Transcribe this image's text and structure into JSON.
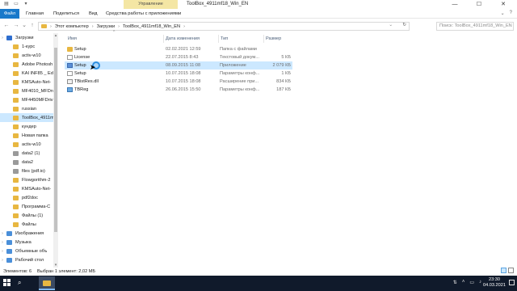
{
  "window": {
    "title": "ToolBox_4911mf18_Win_EN",
    "manage_tab": "Управление",
    "controls": [
      "—",
      "☐",
      "✕"
    ]
  },
  "ribbon": {
    "tabs": [
      "Файл",
      "Главная",
      "Поделиться",
      "Вид",
      "Средства работы с приложениями"
    ]
  },
  "address": {
    "segments": [
      "Этот компьютер",
      "Загрузки",
      "ToolBox_4911mf18_Win_EN"
    ],
    "search_placeholder": "Поиск: ToolBox_4911mf18_Win_EN"
  },
  "sidebar": {
    "items": [
      {
        "label": "Загрузки",
        "icon": "download-icon",
        "color": "#2f6fcf"
      },
      {
        "label": "1-курс",
        "icon": "folder-icon",
        "color": "#e8b741"
      },
      {
        "label": "activ-w10",
        "icon": "folder-icon",
        "color": "#e8b741"
      },
      {
        "label": "Adobe Photosh",
        "icon": "folder-icon",
        "color": "#e8b741"
      },
      {
        "label": "KAI INF85 _ Edu",
        "icon": "folder-icon",
        "color": "#e8b741"
      },
      {
        "label": "KMSAuto-Net-",
        "icon": "folder-icon",
        "color": "#e8b741"
      },
      {
        "label": "MF4010_MFDrv",
        "icon": "folder-icon",
        "color": "#e8b741"
      },
      {
        "label": "MF4450MFDriv",
        "icon": "folder-icon",
        "color": "#e8b741"
      },
      {
        "label": "russian",
        "icon": "folder-icon",
        "color": "#e8b741"
      },
      {
        "label": "ToolBox_4911m",
        "icon": "folder-icon",
        "color": "#e8b741",
        "selected": true
      },
      {
        "label": "кундер",
        "icon": "folder-icon",
        "color": "#e8b741"
      },
      {
        "label": "Новая папка",
        "icon": "folder-icon",
        "color": "#e8b741"
      },
      {
        "label": "activ-w10",
        "icon": "folder-icon",
        "color": "#e8b741"
      },
      {
        "label": "data2 (1)",
        "icon": "file-icon",
        "color": "#9a9a9a"
      },
      {
        "label": "data2",
        "icon": "file-icon",
        "color": "#9a9a9a"
      },
      {
        "label": "files (pdf.io)",
        "icon": "file-icon",
        "color": "#9a9a9a"
      },
      {
        "label": "Flowgorithm-2",
        "icon": "folder-icon",
        "color": "#e8b741"
      },
      {
        "label": "KMSAuto-Net-",
        "icon": "folder-icon",
        "color": "#e8b741"
      },
      {
        "label": "pdf2doc",
        "icon": "folder-icon",
        "color": "#e8b741"
      },
      {
        "label": "Программа-C",
        "icon": "folder-icon",
        "color": "#e8b741"
      },
      {
        "label": "Файлы (1)",
        "icon": "folder-icon",
        "color": "#e8b741"
      },
      {
        "label": "Файлы",
        "icon": "folder-icon",
        "color": "#e8b741"
      },
      {
        "label": "Изображения",
        "icon": "images-icon",
        "color": "#4a8fd9"
      },
      {
        "label": "Музыка",
        "icon": "music-icon",
        "color": "#4a8fd9"
      },
      {
        "label": "Объемные объ",
        "icon": "3d-objects-icon",
        "color": "#4a8fd9"
      },
      {
        "label": "Рабочий стол",
        "icon": "desktop-icon",
        "color": "#4a8fd9"
      }
    ]
  },
  "columns": {
    "name": "Имя",
    "date": "Дата изменения",
    "type": "Тип",
    "size": "Размер"
  },
  "files": [
    {
      "name": "Setup",
      "date": "02.02.2021 12:59",
      "type": "Папка с файлами",
      "size": "",
      "icon": "folder-icon"
    },
    {
      "name": "License",
      "date": "22.07.2015 8:43",
      "type": "Текстовый докум...",
      "size": "5 КБ",
      "icon": "text-file-icon"
    },
    {
      "name": "Setup",
      "date": "08.09.2015 11:08",
      "type": "Приложение",
      "size": "2 079 КБ",
      "icon": "application-icon",
      "selected": true
    },
    {
      "name": "Setup",
      "date": "10.07.2015 18:08",
      "type": "Параметры конф...",
      "size": "1 КБ",
      "icon": "config-file-icon"
    },
    {
      "name": "TBistRes.dll",
      "date": "10.07.2015 18:08",
      "type": "Расширение при...",
      "size": "834 КБ",
      "icon": "dll-file-icon"
    },
    {
      "name": "TBReg",
      "date": "26.06.2015 15:50",
      "type": "Параметры конф...",
      "size": "187 КБ",
      "icon": "config-file-icon"
    }
  ],
  "status": {
    "count": "Элементов: 6",
    "selection": "Выбран 1 элемент: 2,02 МБ"
  },
  "taskbar": {
    "time": "23:30",
    "date": "04.03.2021"
  }
}
